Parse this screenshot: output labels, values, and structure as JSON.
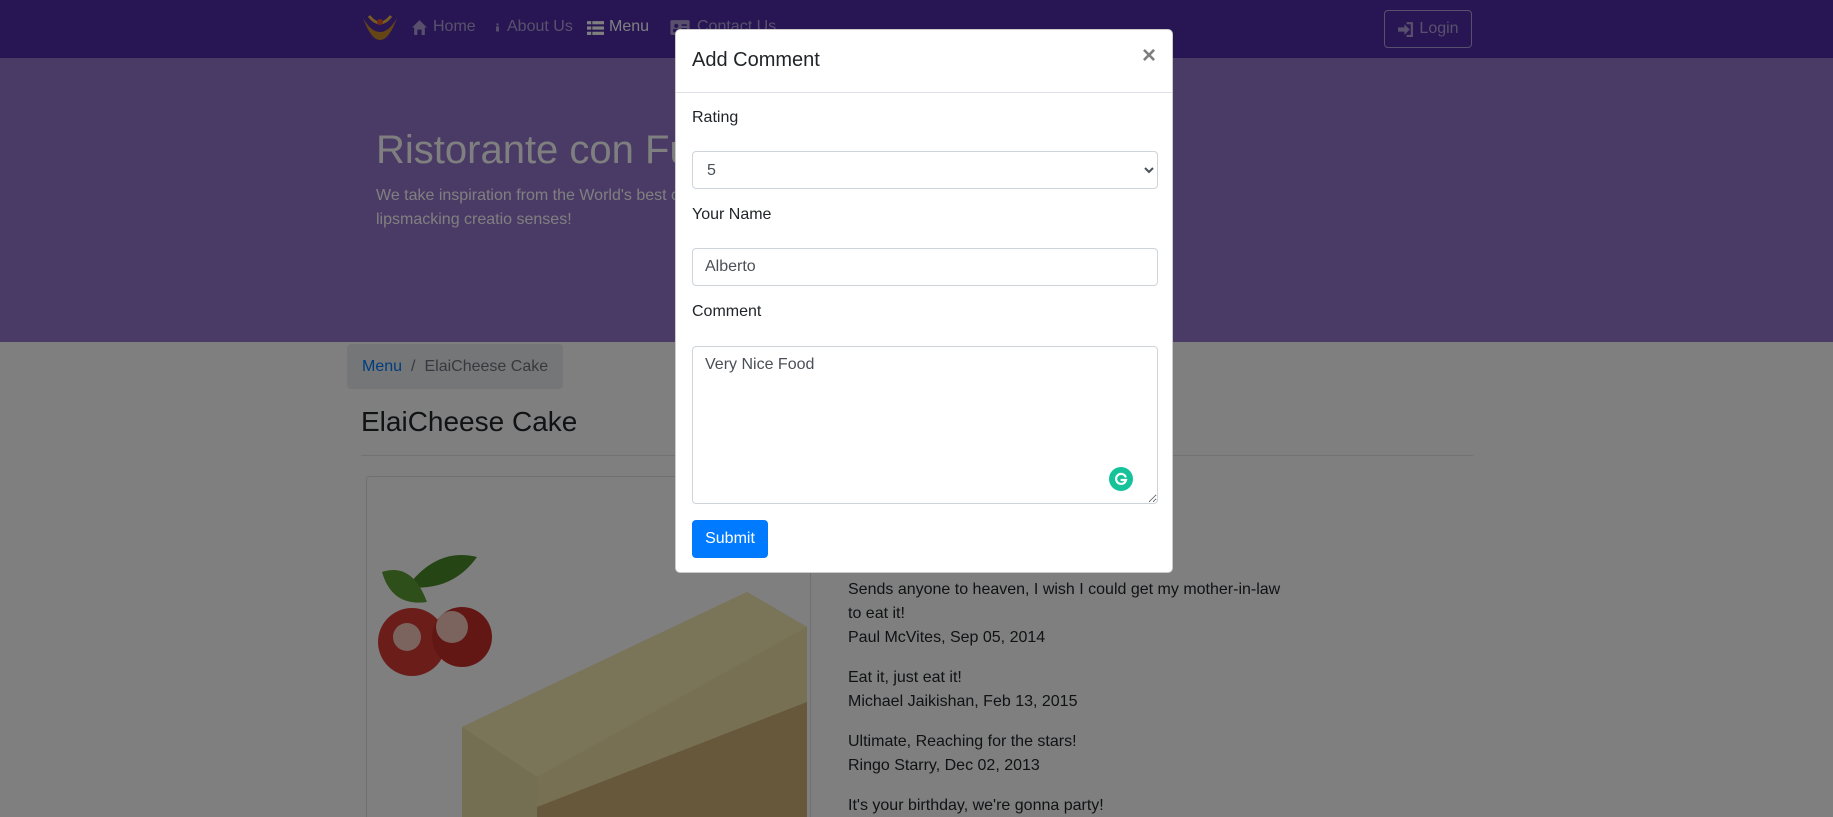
{
  "navbar": {
    "items": [
      {
        "label": "Home",
        "icon": "home-icon"
      },
      {
        "label": "About Us",
        "icon": "info-icon"
      },
      {
        "label": "Menu",
        "icon": "list-icon",
        "active": true
      },
      {
        "label": "Contact Us",
        "icon": "address-card-icon"
      }
    ],
    "login_label": "Login",
    "colors": {
      "primary": "#512da8",
      "jumbotron": "#9575cd"
    }
  },
  "jumbotron": {
    "title": "Ristorante con Fu",
    "text": "We take inspiration from the World's best c fusion experience. Our lipsmacking creatio senses!"
  },
  "breadcrumb": {
    "link": "Menu",
    "separator": "/",
    "current": "ElaiCheese Cake"
  },
  "dish": {
    "title": "ElaiCheese Cake"
  },
  "comments": [
    {
      "text": "Sends anyone to heaven, I wish I could get my mother-in-law to eat it!",
      "author": "Paul McVites, Sep 05, 2014"
    },
    {
      "text": "Eat it, just eat it!",
      "author": "Michael Jaikishan, Feb 13, 2015"
    },
    {
      "text": "Ultimate, Reaching for the stars!",
      "author": "Ringo Starry, Dec 02, 2013"
    },
    {
      "text": "It's your birthday, we're gonna party!",
      "author": ""
    }
  ],
  "modal": {
    "title": "Add Comment",
    "close": "×",
    "rating_label": "Rating",
    "rating_value": "5",
    "name_label": "Your Name",
    "name_value": "Alberto",
    "comment_label": "Comment",
    "comment_value": "Very Nice Food",
    "submit_label": "Submit",
    "submit_color": "#007bff"
  }
}
